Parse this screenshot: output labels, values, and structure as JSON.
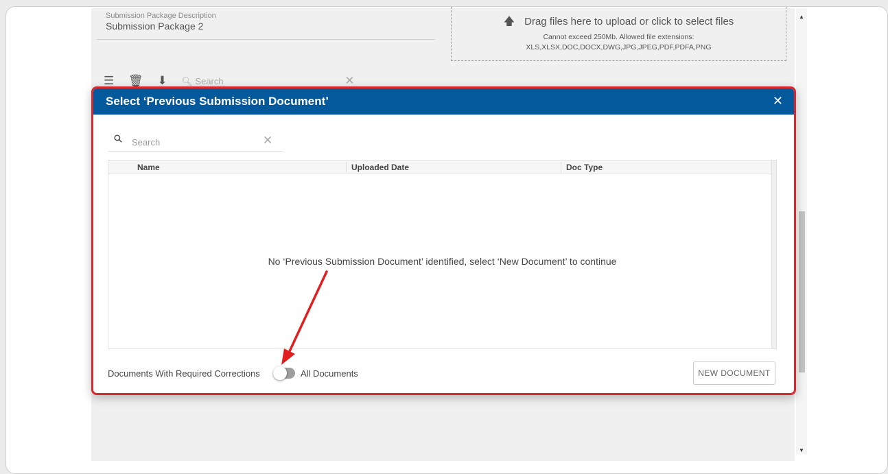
{
  "background": {
    "description_label": "Submission Package Description",
    "description_value": "Submission Package 2",
    "upload": {
      "main_text": "Drag files here to upload or click to select files",
      "line1": "Cannot exceed 250Mb. Allowed file extensions:",
      "line2": "XLS,XLSX,DOC,DOCX,DWG,JPG,JPEG,PDF,PDFA,PNG"
    },
    "toolbar": {
      "search_placeholder": "Search"
    }
  },
  "dialog": {
    "title": "Select ‘Previous Submission Document’",
    "search_placeholder": "Search",
    "columns": [
      "Name",
      "Uploaded Date",
      "Doc Type"
    ],
    "empty_message": "No ‘Previous Submission Document’ identified, select ‘New Document’ to continue",
    "toggle_left_label": "Documents With Required Corrections",
    "toggle_right_label": "All Documents",
    "toggle_on": false,
    "new_document_label": "NEW DOCUMENT"
  },
  "icons": {
    "close": "close-icon",
    "search": "search-icon",
    "upload": "upload-icon"
  },
  "colors": {
    "header_blue": "#03599c",
    "highlight_red": "#d7282f"
  }
}
